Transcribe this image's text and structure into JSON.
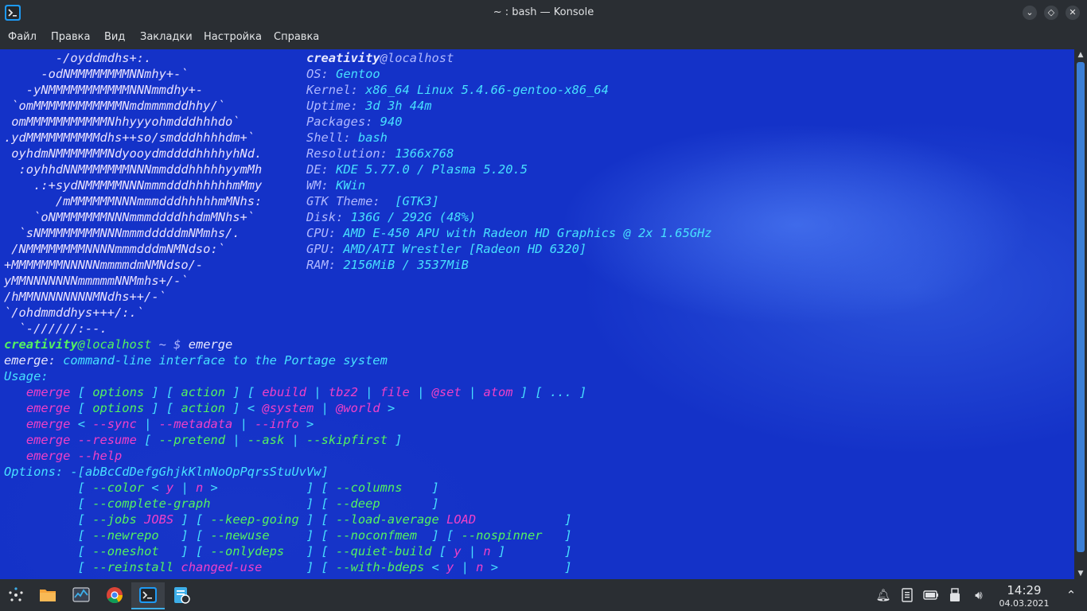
{
  "window": {
    "title": "~ : bash — Konsole"
  },
  "menu": [
    "Файл",
    "Правка",
    "Вид",
    "Закладки",
    "Настройка",
    "Справка"
  ],
  "neofetch": {
    "logo": [
      "       -/oyddmdhs+:.",
      "     -odNMMMMMMMMNNmhy+-`",
      "   -yNMMMMMMMMMMMNNNmmdhy+-",
      " `omMMMMMMMMMMMMNmdmmmmddhhy/`",
      " omMMMMMMMMMMMNhhyyyohmdddhhhdo`",
      ".ydMMMMMMMMMMdhs++so/smdddhhhhdm+`",
      " oyhdmNMMMMMMMNdyooydmddddhhhhyhNd.",
      "  :oyhhdNNMMMMMMMNNNmmdddhhhhhyymMh",
      "    .:+sydNMMMMMNNNmmmdddhhhhhhmMmy",
      "       /mMMMMMMNNNmmmdddhhhhhmMNhs:",
      "    `oNMMMMMMMNNNmmmddddhhdmMNhs+`",
      "  `sNMMMMMMMMNNNmmmdddddmNMmhs/.",
      " /NMMMMMMMMNNNNmmmdddmNMNdso:`",
      "+MMMMMMMNNNNNmmmmdmNMNdso/-",
      "yMMNNNNNNNmmmmmNNMmhs+/-`",
      "/hMMNNNNNNNNMNdhs++/-`",
      "`/ohdmmddhys+++/:.`",
      "  `-//////:--."
    ],
    "user": "creativity",
    "host": "@localhost",
    "info": [
      {
        "k": "OS:",
        "v": " Gentoo"
      },
      {
        "k": "Kernel:",
        "v": " x86_64 Linux 5.4.66-gentoo-x86_64"
      },
      {
        "k": "Uptime:",
        "v": " 3d 3h 44m"
      },
      {
        "k": "Packages:",
        "v": " 940"
      },
      {
        "k": "Shell:",
        "v": " bash"
      },
      {
        "k": "Resolution:",
        "v": " 1366x768"
      },
      {
        "k": "DE:",
        "v": " KDE 5.77.0 / Plasma 5.20.5"
      },
      {
        "k": "WM:",
        "v": " KWin"
      },
      {
        "k": "GTK Theme:",
        "v": "  [GTK3]"
      },
      {
        "k": "Disk:",
        "v": " 136G / 292G (48%)"
      },
      {
        "k": "CPU:",
        "v": " AMD E-450 APU with Radeon HD Graphics @ 2x 1.65GHz"
      },
      {
        "k": "GPU:",
        "v": " AMD/ATI Wrestler [Radeon HD 6320]"
      },
      {
        "k": "RAM:",
        "v": " 2156MiB / 3537MiB"
      }
    ]
  },
  "prompt": {
    "user": "creativity",
    "host": "@localhost",
    "path": " ~ ",
    "sym": "$",
    "cmd": " emerge"
  },
  "emerge": {
    "l1a": "emerge:",
    "l1b": " command-line interface to the Portage system",
    "usage": "Usage:",
    "u1": [
      "   ",
      "emerge",
      " [ ",
      "options",
      " ] [ ",
      "action",
      " ] [ ",
      "ebuild",
      " | ",
      "tbz2",
      " | ",
      "file",
      " | ",
      "@set",
      " | ",
      "atom",
      " ] [ ... ]"
    ],
    "u2": [
      "   ",
      "emerge",
      " [ ",
      "options",
      " ] [ ",
      "action",
      " ] < ",
      "@system",
      " | ",
      "@world",
      " >"
    ],
    "u3": [
      "   ",
      "emerge",
      " < ",
      "--sync",
      " | ",
      "--metadata",
      " | ",
      "--info",
      " >"
    ],
    "u4": [
      "   ",
      "emerge",
      " ",
      "--resume",
      " [ ",
      "--pretend",
      " | ",
      "--ask",
      " | ",
      "--skipfirst",
      " ]"
    ],
    "u5": [
      "   ",
      "emerge",
      " ",
      "--help"
    ],
    "opt": [
      "Options:",
      " -[abBcCdDefgGhjkKlnNoOpPqrsStuUvVw]"
    ],
    "o1": [
      "          [ ",
      "--color",
      " < ",
      "y",
      " | ",
      "n",
      " >            ] [ ",
      "--columns",
      "    ]"
    ],
    "o2": [
      "          [ ",
      "--complete-graph",
      "             ] [ ",
      "--deep",
      "       ]"
    ],
    "o3": [
      "          [ ",
      "--jobs",
      " ",
      "JOBS",
      " ] [ ",
      "--keep-going",
      " ] [ ",
      "--load-average",
      " ",
      "LOAD",
      "            ]"
    ],
    "o4": [
      "          [ ",
      "--newrepo",
      "   ] [ ",
      "--newuse",
      "     ] [ ",
      "--noconfmem",
      "  ] [ ",
      "--nospinner",
      "   ]"
    ],
    "o5": [
      "          [ ",
      "--oneshot",
      "   ] [ ",
      "--onlydeps",
      "   ] [ ",
      "--quiet-build",
      " [ ",
      "y",
      " | ",
      "n",
      " ]        ]"
    ],
    "o6": [
      "          [ ",
      "--reinstall",
      " ",
      "changed-use",
      "      ] [ ",
      "--with-bdeps",
      " < ",
      "y",
      " | ",
      "n",
      " >         ]"
    ]
  },
  "clock": {
    "time": "14:29",
    "date": "04.03.2021"
  }
}
